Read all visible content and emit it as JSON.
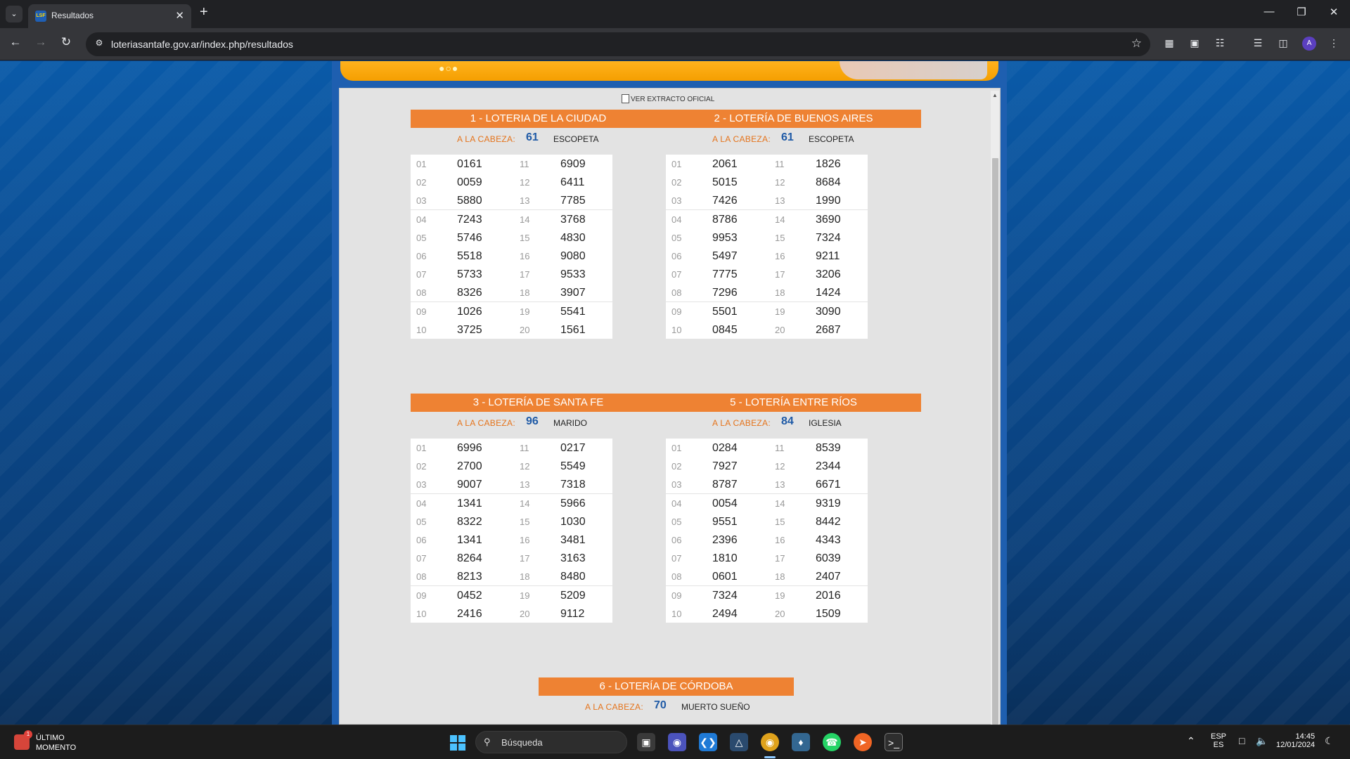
{
  "browser": {
    "tab_title": "Resultados",
    "tab_favicon": "LSF",
    "url": "loteriasantafe.gov.ar/index.php/resultados",
    "profile_initial": "A"
  },
  "page": {
    "extract_link": "VER EXTRACTO OFICIAL",
    "cabeza_label": "A LA CABEZA:",
    "lotteries": [
      {
        "title": "1 - LOTERIA DE LA CIUDAD",
        "cabeza_number": "61",
        "cabeza_word": "ESCOPETA",
        "positions": [
          "01",
          "02",
          "03",
          "04",
          "05",
          "06",
          "07",
          "08",
          "09",
          "10",
          "11",
          "12",
          "13",
          "14",
          "15",
          "16",
          "17",
          "18",
          "19",
          "20"
        ],
        "numbers": [
          "0161",
          "0059",
          "5880",
          "7243",
          "5746",
          "5518",
          "5733",
          "8326",
          "1026",
          "3725",
          "6909",
          "6411",
          "7785",
          "3768",
          "4830",
          "9080",
          "9533",
          "3907",
          "5541",
          "1561"
        ]
      },
      {
        "title": "2 - LOTERÍA DE BUENOS AIRES",
        "cabeza_number": "61",
        "cabeza_word": "ESCOPETA",
        "positions": [
          "01",
          "02",
          "03",
          "04",
          "05",
          "06",
          "07",
          "08",
          "09",
          "10",
          "11",
          "12",
          "13",
          "14",
          "15",
          "16",
          "17",
          "18",
          "19",
          "20"
        ],
        "numbers": [
          "2061",
          "5015",
          "7426",
          "8786",
          "9953",
          "5497",
          "7775",
          "7296",
          "5501",
          "0845",
          "1826",
          "8684",
          "1990",
          "3690",
          "7324",
          "9211",
          "3206",
          "1424",
          "3090",
          "2687"
        ]
      },
      {
        "title": "3 - LOTERÍA DE SANTA FE",
        "cabeza_number": "96",
        "cabeza_word": "MARIDO",
        "positions": [
          "01",
          "02",
          "03",
          "04",
          "05",
          "06",
          "07",
          "08",
          "09",
          "10",
          "11",
          "12",
          "13",
          "14",
          "15",
          "16",
          "17",
          "18",
          "19",
          "20"
        ],
        "numbers": [
          "6996",
          "2700",
          "9007",
          "1341",
          "8322",
          "1341",
          "8264",
          "8213",
          "0452",
          "2416",
          "0217",
          "5549",
          "7318",
          "5966",
          "1030",
          "3481",
          "3163",
          "8480",
          "5209",
          "9112"
        ]
      },
      {
        "title": "5 - LOTERÍA ENTRE RÍOS",
        "cabeza_number": "84",
        "cabeza_word": "IGLESIA",
        "positions": [
          "01",
          "02",
          "03",
          "04",
          "05",
          "06",
          "07",
          "08",
          "09",
          "10",
          "11",
          "12",
          "13",
          "14",
          "15",
          "16",
          "17",
          "18",
          "19",
          "20"
        ],
        "numbers": [
          "0284",
          "7927",
          "8787",
          "0054",
          "9551",
          "2396",
          "1810",
          "0601",
          "7324",
          "2494",
          "8539",
          "2344",
          "6671",
          "9319",
          "8442",
          "4343",
          "6039",
          "2407",
          "2016",
          "1509"
        ]
      },
      {
        "title": "6 - LOTERÍA DE CÓRDOBA",
        "cabeza_number": "70",
        "cabeza_word": "MUERTO SUEÑO",
        "positions": [],
        "numbers": []
      }
    ]
  },
  "taskbar": {
    "news_line1": "ÚLTIMO",
    "news_line2": "MOMENTO",
    "news_badge": "1",
    "search_placeholder": "Búsqueda",
    "lang_line1": "ESP",
    "lang_line2": "ES",
    "time": "14:45",
    "date": "12/01/2024"
  },
  "colors": {
    "section_header": "#ee8233",
    "cabeza_label": "#e4731b",
    "cabeza_number": "#1f5aa6",
    "panel_bg": "#e3e3e3"
  }
}
